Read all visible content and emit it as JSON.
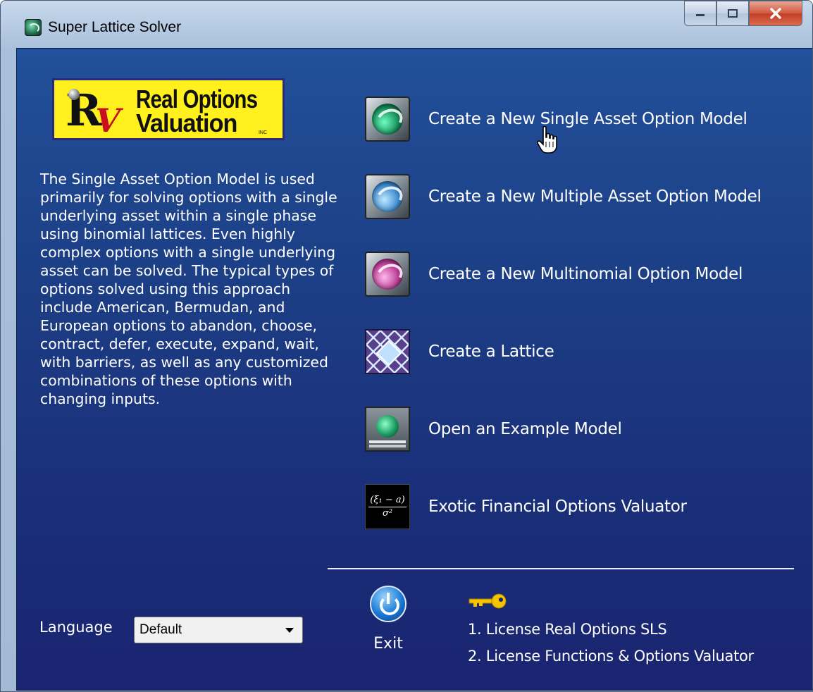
{
  "window": {
    "title": "Super Lattice Solver",
    "controls": [
      "minimize",
      "maximize",
      "close"
    ]
  },
  "logo": {
    "line1": "Real Options",
    "line2": "Valuation",
    "small": "INC"
  },
  "description": "The Single Asset Option Model is used primarily for solving options with a single underlying asset within a single phase using binomial lattices. Even highly complex options with a single underlying asset can be solved. The typical types of options solved using this approach include American, Bermudan, and European options to abandon, choose, contract, defer, execute, expand, wait, with barriers, as well as any customized combinations of these options with changing inputs.",
  "menu": {
    "items": [
      {
        "label": "Create a New Single Asset Option Model",
        "icon": "green-orb-icon"
      },
      {
        "label": "Create a New Multiple Asset Option Model",
        "icon": "blue-orb-icon"
      },
      {
        "label": "Create a New Multinomial Option Model",
        "icon": "pink-orb-icon"
      },
      {
        "label": "Create a Lattice",
        "icon": "lattice-icon"
      },
      {
        "label": "Open an Example Model",
        "icon": "monitor-icon"
      },
      {
        "label": "Exotic Financial Options Valuator",
        "icon": "formula-icon"
      }
    ]
  },
  "formula_icon": {
    "top": "(ξ₁ − a)",
    "bottom": "σ²"
  },
  "footer": {
    "exit_label": "Exit",
    "license1": "1. License Real Options SLS",
    "license2": "2. License Functions & Options Valuator",
    "language_label": "Language",
    "language_value": "Default"
  },
  "colors": {
    "panel_top": "#22509a",
    "panel_bottom": "#1a2470",
    "text": "#ffffff",
    "logo_bg": "#fff01e"
  }
}
